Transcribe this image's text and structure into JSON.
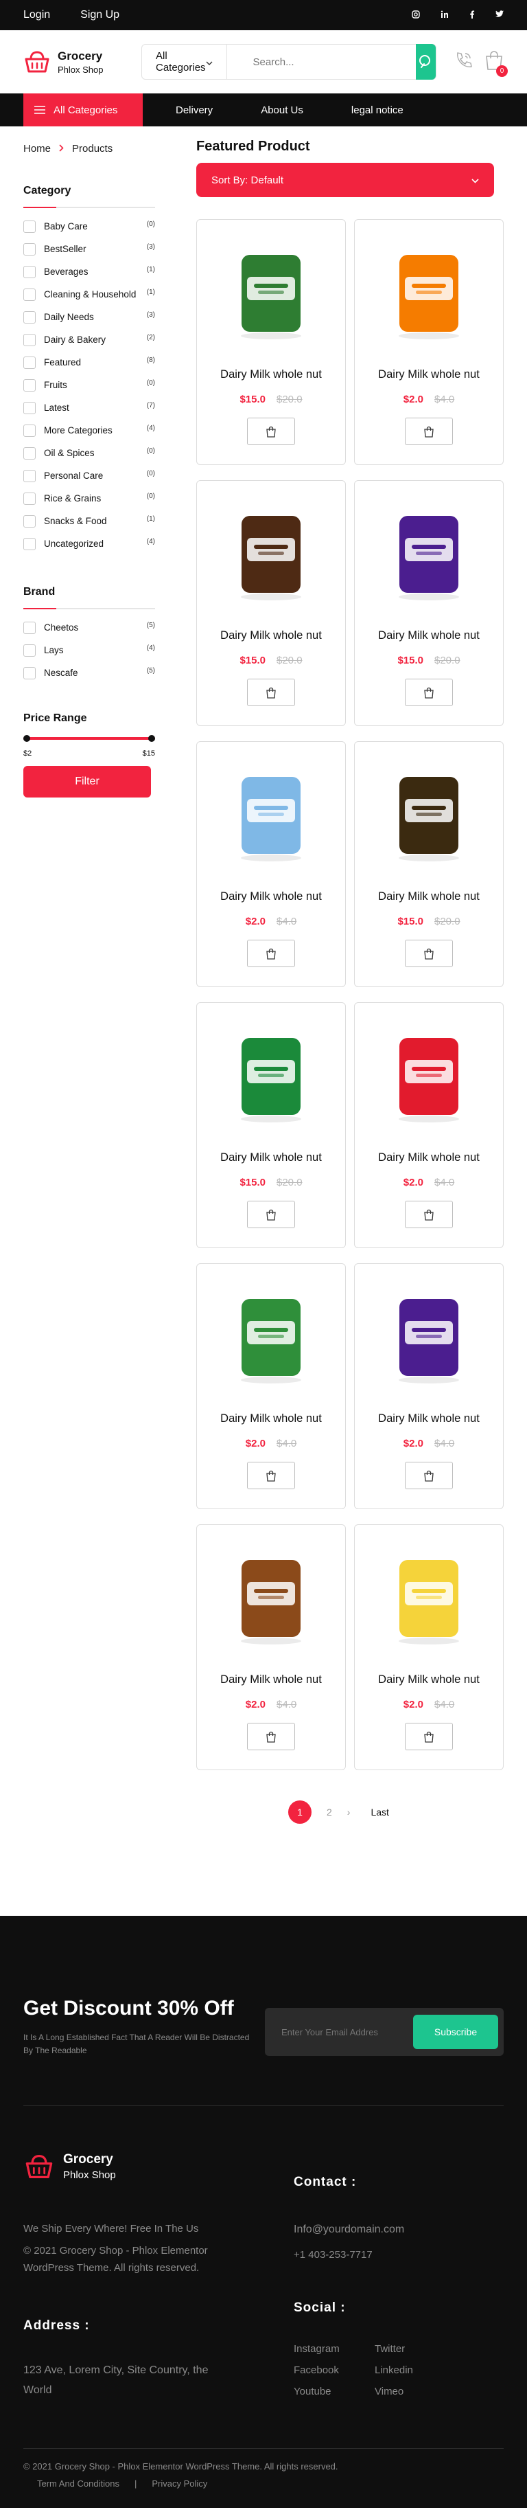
{
  "topbar": {
    "login": "Login",
    "signup": "Sign Up",
    "socials": [
      "instagram-icon",
      "linkedin-icon",
      "facebook-icon",
      "twitter-icon"
    ]
  },
  "header": {
    "brand": "Grocery",
    "sub": "Phlox Shop",
    "category_select": "All Categories",
    "search_placeholder": "Search...",
    "cart_count": "0"
  },
  "nav": {
    "all_categories": "All Categories",
    "links": [
      "Delivery",
      "About Us",
      "legal notice"
    ]
  },
  "breadcrumb": {
    "home": "Home",
    "current": "Products"
  },
  "sidebar": {
    "category_title": "Category",
    "categories": [
      {
        "name": "Baby Care",
        "count": "(0)"
      },
      {
        "name": "BestSeller",
        "count": "(3)"
      },
      {
        "name": "Beverages",
        "count": "(1)"
      },
      {
        "name": "Cleaning & Household",
        "count": "(1)"
      },
      {
        "name": "Daily Needs",
        "count": "(3)"
      },
      {
        "name": "Dairy & Bakery",
        "count": "(2)"
      },
      {
        "name": "Featured",
        "count": "(8)"
      },
      {
        "name": "Fruits",
        "count": "(0)"
      },
      {
        "name": "Latest",
        "count": "(7)"
      },
      {
        "name": "More Categories",
        "count": "(4)"
      },
      {
        "name": "Oil & Spices",
        "count": "(0)"
      },
      {
        "name": "Personal Care",
        "count": "(0)"
      },
      {
        "name": "Rice & Grains",
        "count": "(0)"
      },
      {
        "name": "Snacks & Food",
        "count": "(1)"
      },
      {
        "name": "Uncategorized",
        "count": "(4)"
      }
    ],
    "brand_title": "Brand",
    "brands": [
      {
        "name": "Cheetos",
        "count": "(5)"
      },
      {
        "name": "Lays",
        "count": "(4)"
      },
      {
        "name": "Nescafe",
        "count": "(5)"
      }
    ],
    "price_title": "Price Range",
    "price_min": "$2",
    "price_max": "$15",
    "filter_button": "Filter"
  },
  "content": {
    "title": "Featured Product",
    "sort": "Sort By: Default",
    "products": [
      {
        "name": "Dairy Milk whole nut",
        "price": "$15.0",
        "old_price": "$20.0",
        "image": "yogurt-cup-image",
        "color": "#2e7d32"
      },
      {
        "name": "Dairy Milk whole nut",
        "price": "$2.0",
        "old_price": "$4.0",
        "image": "cheetos-bag-image",
        "color": "#f57c00"
      },
      {
        "name": "Dairy Milk whole nut",
        "price": "$15.0",
        "old_price": "$20.0",
        "image": "nescafe-jar-image",
        "color": "#4e2a14"
      },
      {
        "name": "Dairy Milk whole nut",
        "price": "$15.0",
        "old_price": "$20.0",
        "image": "dairy-milk-box-image",
        "color": "#4b1e8f"
      },
      {
        "name": "Dairy Milk whole nut",
        "price": "$2.0",
        "old_price": "$4.0",
        "image": "baby-bottle-pack-image",
        "color": "#7fb8e6"
      },
      {
        "name": "Dairy Milk whole nut",
        "price": "$15.0",
        "old_price": "$20.0",
        "image": "marmite-jar-image",
        "color": "#3b2a10"
      },
      {
        "name": "Dairy Milk whole nut",
        "price": "$15.0",
        "old_price": "$20.0",
        "image": "milo-pouch-image",
        "color": "#1b8a3a"
      },
      {
        "name": "Dairy Milk whole nut",
        "price": "$2.0",
        "old_price": "$4.0",
        "image": "special-k-box-image",
        "color": "#e21b2d"
      },
      {
        "name": "Dairy Milk whole nut",
        "price": "$2.0",
        "old_price": "$4.0",
        "image": "activia-pack-image",
        "color": "#2f8f3a"
      },
      {
        "name": "Dairy Milk whole nut",
        "price": "$2.0",
        "old_price": "$4.0",
        "image": "dairy-milk-bar-image",
        "color": "#4b1e8f"
      },
      {
        "name": "Dairy Milk whole nut",
        "price": "$2.0",
        "old_price": "$4.0",
        "image": "nutella-jar-image",
        "color": "#8b4a1a"
      },
      {
        "name": "Dairy Milk whole nut",
        "price": "$2.0",
        "old_price": "$4.0",
        "image": "domino-sugar-bag-image",
        "color": "#f5d33a"
      }
    ],
    "pagination": {
      "current": "1",
      "next_page": "2",
      "next": "›",
      "last": "Last"
    }
  },
  "footer": {
    "discount_title": "Get Discount 30% Off",
    "discount_text": "It Is A Long Established Fact That A Reader Will Be Distracted By The Readable",
    "email_placeholder": "Enter Your Email Addres",
    "subscribe": "Subscribe",
    "brand": "Grocery",
    "sub": "Phlox Shop",
    "contact_title": "Contact :",
    "shipping": "We Ship Every Where! Free In The Us",
    "copyright_line": "© 2021 Grocery Shop - Phlox Elementor WordPress Theme. All rights reserved.",
    "email": "Info@yourdomain.com",
    "phone": "+1 403-253-7717",
    "address_title": "Address :",
    "address": "123 Ave, Lorem City, Site Country, the World",
    "social_title": "Social :",
    "social_links": [
      "Instagram",
      "Twitter",
      "Facebook",
      "Linkedin",
      "Youtube",
      "Vimeo"
    ],
    "bottom_copyright": "© 2021 Grocery Shop - Phlox Elementor WordPress Theme. All rights reserved.",
    "terms": "Term And Conditions",
    "divider": "|",
    "privacy": "Privacy Policy"
  }
}
